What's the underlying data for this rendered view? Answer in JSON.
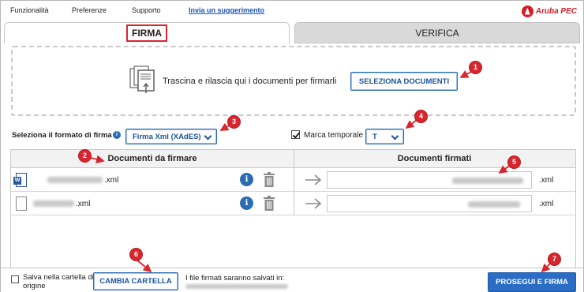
{
  "menu": {
    "items": [
      "Funzionalità",
      "Preferenze",
      "Supporto"
    ],
    "link": "Invia un suggerimento",
    "brand": "Aruba PEC"
  },
  "tabs": [
    {
      "label": "FIRMA",
      "active": true
    },
    {
      "label": "VERIFICA",
      "active": false
    }
  ],
  "dropzone": {
    "text": "Trascina e rilascia qui i documenti per firmarli",
    "button": "SELEZIONA DOCUMENTI"
  },
  "format": {
    "label": "Seleziona il formato di firma",
    "info_icon": "i",
    "selected": "Firma Xml (XAdES)",
    "marca_label": "Marca temporale",
    "marca_checked": true,
    "marca_selected": "T"
  },
  "table": {
    "headers": [
      "Documenti da firmare",
      "Documenti firmati"
    ],
    "rows": [
      {
        "ext": ".xml",
        "icon": "word-file-icon",
        "out_ext": ".xml"
      },
      {
        "ext": ".xml",
        "icon": "blank-file-icon",
        "out_ext": ".xml"
      }
    ],
    "info_icon": "i"
  },
  "bottom": {
    "salva_label": "Salva nella cartella di origine",
    "cambia_button": "CAMBIA CARTELLA",
    "path_label": "I file firmati saranno salvati in:",
    "proceed_button": "PROSEGUI E FIRMA"
  },
  "callouts": [
    "1",
    "2",
    "3",
    "4",
    "5",
    "6",
    "7"
  ],
  "colors": {
    "accent": "#2b6cc4",
    "callout": "#d9262e",
    "brand": "#d21e28"
  }
}
